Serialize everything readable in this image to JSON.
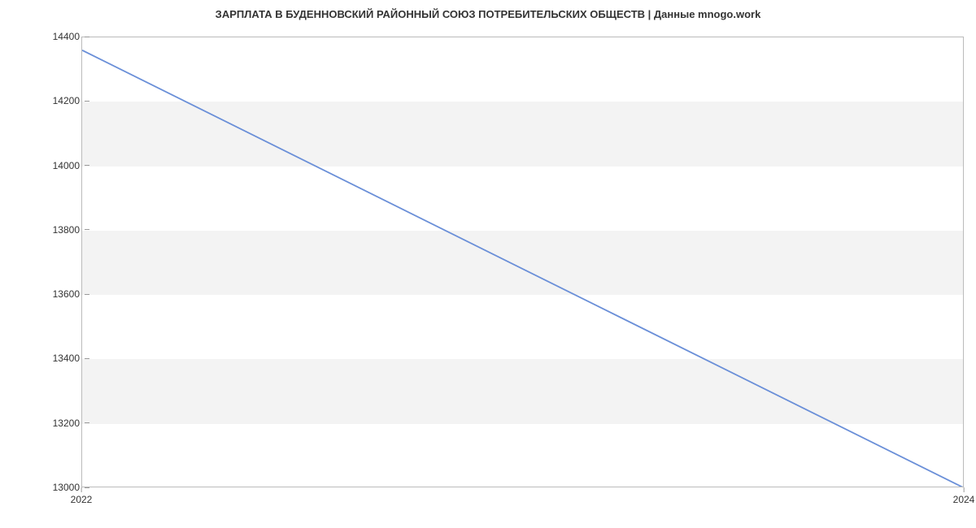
{
  "chart_data": {
    "type": "line",
    "title": "ЗАРПЛАТА В БУДЕННОВСКИЙ РАЙОННЫЙ СОЮЗ ПОТРЕБИТЕЛЬСКИХ ОБЩЕСТВ | Данные mnogo.work",
    "x": [
      2022,
      2024
    ],
    "values": [
      14360,
      13000
    ],
    "xlabel": "",
    "ylabel": "",
    "ylim": [
      13000,
      14400
    ],
    "xlim": [
      2022,
      2024
    ],
    "y_ticks": [
      13000,
      13200,
      13400,
      13600,
      13800,
      14000,
      14200,
      14400
    ],
    "x_ticks": [
      2022,
      2024
    ],
    "line_color": "#6a8fd8"
  }
}
